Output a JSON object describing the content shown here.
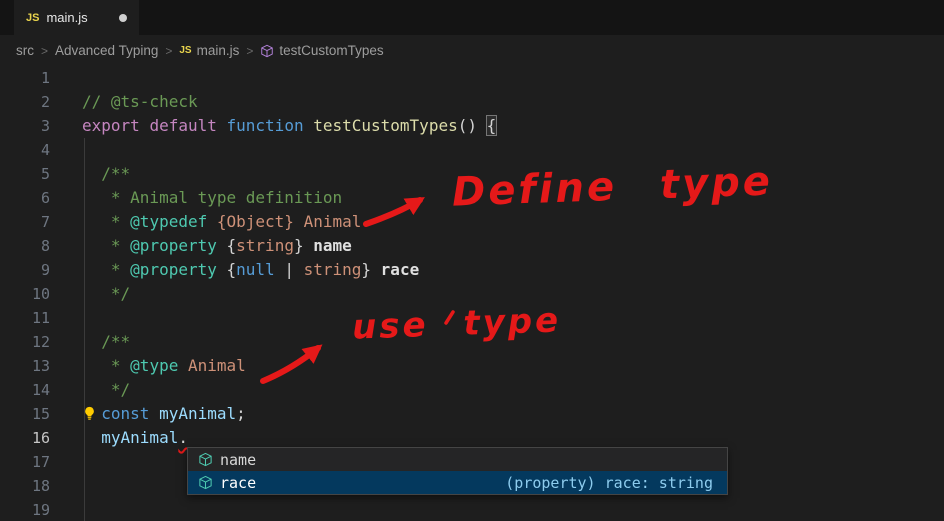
{
  "colors": {
    "editor_bg": "#1e1e1e",
    "tabbar_bg": "#141414",
    "red": "#e51919",
    "comment": "#6A9955",
    "keyword": "#C586C0",
    "kw_blue": "#569CD6",
    "func": "#DCDCAA",
    "type": "#CE9178",
    "jsdoc": "#4EC9B0",
    "variable": "#9CDCFE",
    "prop": "#e0e0e0",
    "punct": "#d4d4d4",
    "line_number": "#6e7681",
    "line_number_active": "#c6c6c6",
    "suggest_bg": "#252526",
    "suggest_selected": "#04395E",
    "lightbulb": "#FFCC00"
  },
  "window": {
    "tab": {
      "icon_label": "JS",
      "title": "main.js",
      "modified": true
    }
  },
  "breadcrumb": {
    "separator": ">",
    "items": [
      {
        "label": "src"
      },
      {
        "label": "Advanced Typing"
      },
      {
        "label": "main.js"
      },
      {
        "label": "testCustomTypes"
      }
    ]
  },
  "editor": {
    "active_line": 16,
    "lines": [
      {
        "n": 1,
        "segments": []
      },
      {
        "n": 2,
        "segments": [
          [
            "// @ts-check",
            "c"
          ]
        ]
      },
      {
        "n": 3,
        "segments": [
          [
            "export",
            "kp"
          ],
          [
            " ",
            "pu"
          ],
          [
            "default",
            "kp"
          ],
          [
            " ",
            "pu"
          ],
          [
            "function",
            "kb"
          ],
          [
            " ",
            "pu"
          ],
          [
            "testCustomTypes",
            "fn"
          ],
          [
            "()",
            "pu"
          ],
          [
            " ",
            "pu"
          ],
          [
            "{",
            "bm"
          ]
        ]
      },
      {
        "n": 4,
        "segments": []
      },
      {
        "n": 5,
        "segments": [
          [
            "  /**",
            "c"
          ]
        ]
      },
      {
        "n": 6,
        "segments": [
          [
            "   * Animal type definition",
            "c"
          ]
        ]
      },
      {
        "n": 7,
        "segments": [
          [
            "   * ",
            "c"
          ],
          [
            "@typedef",
            "jt"
          ],
          [
            " ",
            "pu"
          ],
          [
            "{Object}",
            "ty"
          ],
          [
            " ",
            "pu"
          ],
          [
            "Animal",
            "ty"
          ]
        ]
      },
      {
        "n": 8,
        "segments": [
          [
            "   * ",
            "c"
          ],
          [
            "@property",
            "jt"
          ],
          [
            " ",
            "pu"
          ],
          [
            "{",
            "pu"
          ],
          [
            "string",
            "ty"
          ],
          [
            "}",
            "pu"
          ],
          [
            " ",
            "pu"
          ],
          [
            "name",
            "pr"
          ]
        ]
      },
      {
        "n": 9,
        "segments": [
          [
            "   * ",
            "c"
          ],
          [
            "@property",
            "jt"
          ],
          [
            " ",
            "pu"
          ],
          [
            "{",
            "pu"
          ],
          [
            "null",
            "kb"
          ],
          [
            " | ",
            "pu"
          ],
          [
            "string",
            "ty"
          ],
          [
            "}",
            "pu"
          ],
          [
            " ",
            "pu"
          ],
          [
            "race",
            "pr"
          ]
        ]
      },
      {
        "n": 10,
        "segments": [
          [
            "   */",
            "c"
          ]
        ]
      },
      {
        "n": 11,
        "segments": []
      },
      {
        "n": 12,
        "segments": [
          [
            "  /**",
            "c"
          ]
        ]
      },
      {
        "n": 13,
        "segments": [
          [
            "   * ",
            "c"
          ],
          [
            "@type",
            "jt"
          ],
          [
            " ",
            "pu"
          ],
          [
            "Animal",
            "ty"
          ]
        ]
      },
      {
        "n": 14,
        "segments": [
          [
            "   */",
            "c"
          ]
        ]
      },
      {
        "n": 15,
        "lightbulb": true,
        "segments": [
          [
            "  ",
            "pu"
          ],
          [
            "const",
            "kb"
          ],
          [
            " ",
            "pu"
          ],
          [
            "myAnimal",
            "vb"
          ],
          [
            ";",
            "pu"
          ]
        ]
      },
      {
        "n": 16,
        "active": true,
        "segments": [
          [
            "  ",
            "pu"
          ],
          [
            "myAnimal",
            "vb"
          ],
          [
            ".",
            "er"
          ]
        ]
      },
      {
        "n": 17,
        "segments": []
      },
      {
        "n": 18,
        "segments": []
      },
      {
        "n": 19,
        "segments": []
      }
    ]
  },
  "suggest": {
    "items": [
      {
        "label": "name",
        "selected": false
      },
      {
        "label": "race",
        "detail": "(property) race: string",
        "selected": true
      }
    ]
  },
  "annotations": {
    "define_label": "Define type",
    "use_label": "use type"
  }
}
